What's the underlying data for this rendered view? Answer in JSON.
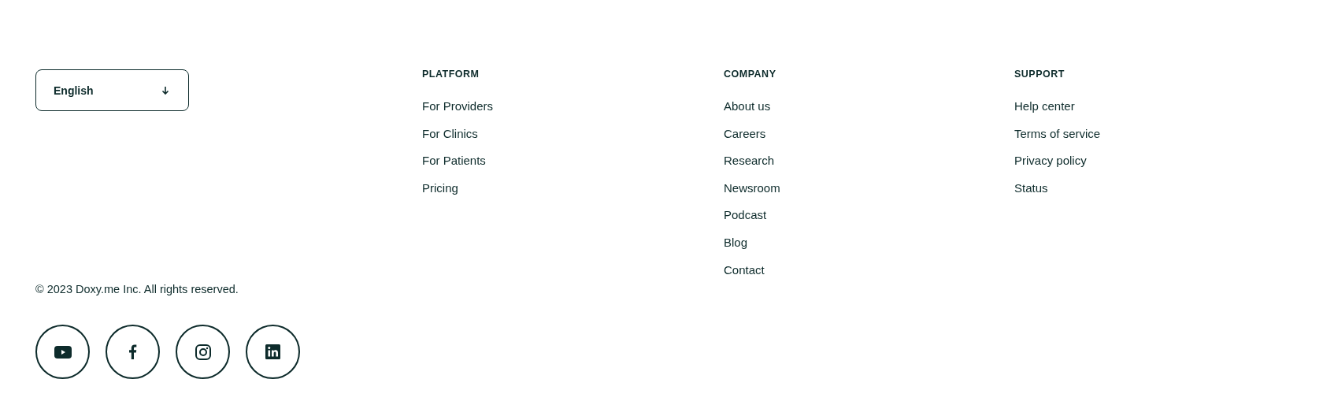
{
  "language_selector": {
    "value": "English"
  },
  "columns": [
    {
      "heading": "PLATFORM",
      "links": [
        "For Providers",
        "For Clinics",
        "For Patients",
        "Pricing"
      ]
    },
    {
      "heading": "COMPANY",
      "links": [
        "About us",
        "Careers",
        "Research",
        "Newsroom",
        "Podcast",
        "Blog",
        "Contact"
      ]
    },
    {
      "heading": "SUPPORT",
      "links": [
        "Help center",
        "Terms of service",
        "Privacy policy",
        "Status"
      ]
    }
  ],
  "copyright": "© 2023 Doxy.me Inc. All rights reserved.",
  "social_links": [
    {
      "kind": "youtube"
    },
    {
      "kind": "facebook"
    },
    {
      "kind": "instagram"
    },
    {
      "kind": "linkedin"
    }
  ]
}
